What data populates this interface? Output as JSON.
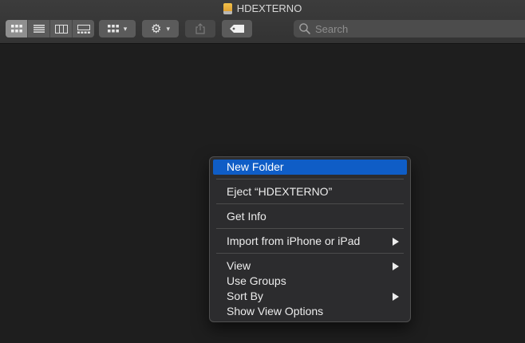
{
  "window": {
    "title": "HDEXTERNO",
    "title_icon": "external-drive-icon"
  },
  "toolbar": {
    "view_modes": [
      "icon-view-icon",
      "list-view-icon",
      "column-view-icon",
      "gallery-view-icon"
    ],
    "active_view": "icon-view-icon",
    "group_icon": "group-icon",
    "action_icon": "gear-icon",
    "share_icon": "share-icon",
    "tags_icon": "tag-icon",
    "search": {
      "placeholder": "Search",
      "value": ""
    }
  },
  "context_menu": {
    "new_folder": "New Folder",
    "eject": "Eject “HDEXTERNO”",
    "get_info": "Get Info",
    "import": "Import from iPhone or iPad",
    "view": "View",
    "use_groups": "Use Groups",
    "sort_by": "Sort By",
    "show_view_options": "Show View Options",
    "highlighted": "New Folder"
  },
  "colors": {
    "highlight": "#0f5dc6",
    "background": "#1e1e1e",
    "toolbar": "#3a3a3a",
    "menu": "#2c2c2e"
  }
}
